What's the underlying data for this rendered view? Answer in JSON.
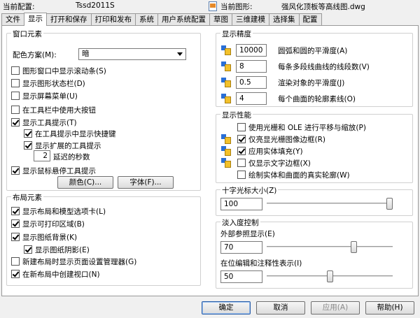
{
  "header": {
    "profile_label": "当前配置:",
    "profile_value": "Tssd2011S",
    "drawing_label": "当前图形:",
    "drawing_value": "强风化顶板等高线图.dwg"
  },
  "tabs": [
    "文件",
    "显示",
    "打开和保存",
    "打印和发布",
    "系统",
    "用户系统配置",
    "草图",
    "三维建模",
    "选择集",
    "配置"
  ],
  "active_tab": "显示",
  "window_elements": {
    "title": "窗口元素",
    "color_scheme_label": "配色方案(M):",
    "color_scheme_value": "暗",
    "options": [
      {
        "label": "图形窗口中显示滚动条(S)",
        "checked": false
      },
      {
        "label": "显示图形状态栏(D)",
        "checked": false
      },
      {
        "label": "显示屏幕菜单(U)",
        "checked": false
      },
      {
        "label": "在工具栏中使用大按钮",
        "checked": false
      },
      {
        "label": "显示工具提示(T)",
        "checked": true
      },
      {
        "label": "在工具提示中显示快捷键",
        "checked": true
      },
      {
        "label": "显示扩展的工具提示",
        "checked": true
      }
    ],
    "delay_value": "2",
    "delay_label": "延迟的秒数",
    "mouse_hover_label": "显示鼠标悬停工具提示",
    "mouse_hover_checked": true,
    "colors_button": "颜色(C)...",
    "fonts_button": "字体(F)..."
  },
  "layout_elements": {
    "title": "布局元素",
    "options": [
      {
        "label": "显示布局和模型选项卡(L)",
        "checked": true
      },
      {
        "label": "显示可打印区域(B)",
        "checked": true
      },
      {
        "label": "显示图纸背景(K)",
        "checked": true
      },
      {
        "label": "显示图纸阴影(E)",
        "checked": true
      },
      {
        "label": "新建布局时显示页面设置管理器(G)",
        "checked": false
      },
      {
        "label": "在新布局中创建视口(N)",
        "checked": true
      }
    ]
  },
  "display_resolution": {
    "title": "显示精度",
    "items": [
      {
        "value": "10000",
        "label": "圆弧和圆的平滑度(A)"
      },
      {
        "value": "8",
        "label": "每条多段线曲线的线段数(V)"
      },
      {
        "value": "0.5",
        "label": "渲染对象的平滑度(J)"
      },
      {
        "value": "4",
        "label": "每个曲面的轮廓素线(O)"
      }
    ]
  },
  "display_performance": {
    "title": "显示性能",
    "options": [
      {
        "label": "使用光栅和 OLE 进行平移与缩放(P)",
        "checked": false
      },
      {
        "label": "仅亮显光栅图像边框(R)",
        "checked": true
      },
      {
        "label": "应用实体填充(Y)",
        "checked": true
      },
      {
        "label": "仅显示文字边框(X)",
        "checked": false
      },
      {
        "label": "绘制实体和曲面的真实轮廓(W)",
        "checked": false
      }
    ]
  },
  "crosshair": {
    "title": "十字光标大小(Z)",
    "value": "100",
    "fraction": 1.0
  },
  "fade_control": {
    "title": "淡入度控制",
    "xref_label": "外部参照显示(E)",
    "xref_value": "70",
    "xref_fraction": 0.7,
    "inplace_label": "在位编辑和注释性表示(I)",
    "inplace_value": "50",
    "inplace_fraction": 0.5
  },
  "footer": {
    "ok": "确定",
    "cancel": "取消",
    "apply": "应用(A)",
    "help": "帮助(H)"
  }
}
